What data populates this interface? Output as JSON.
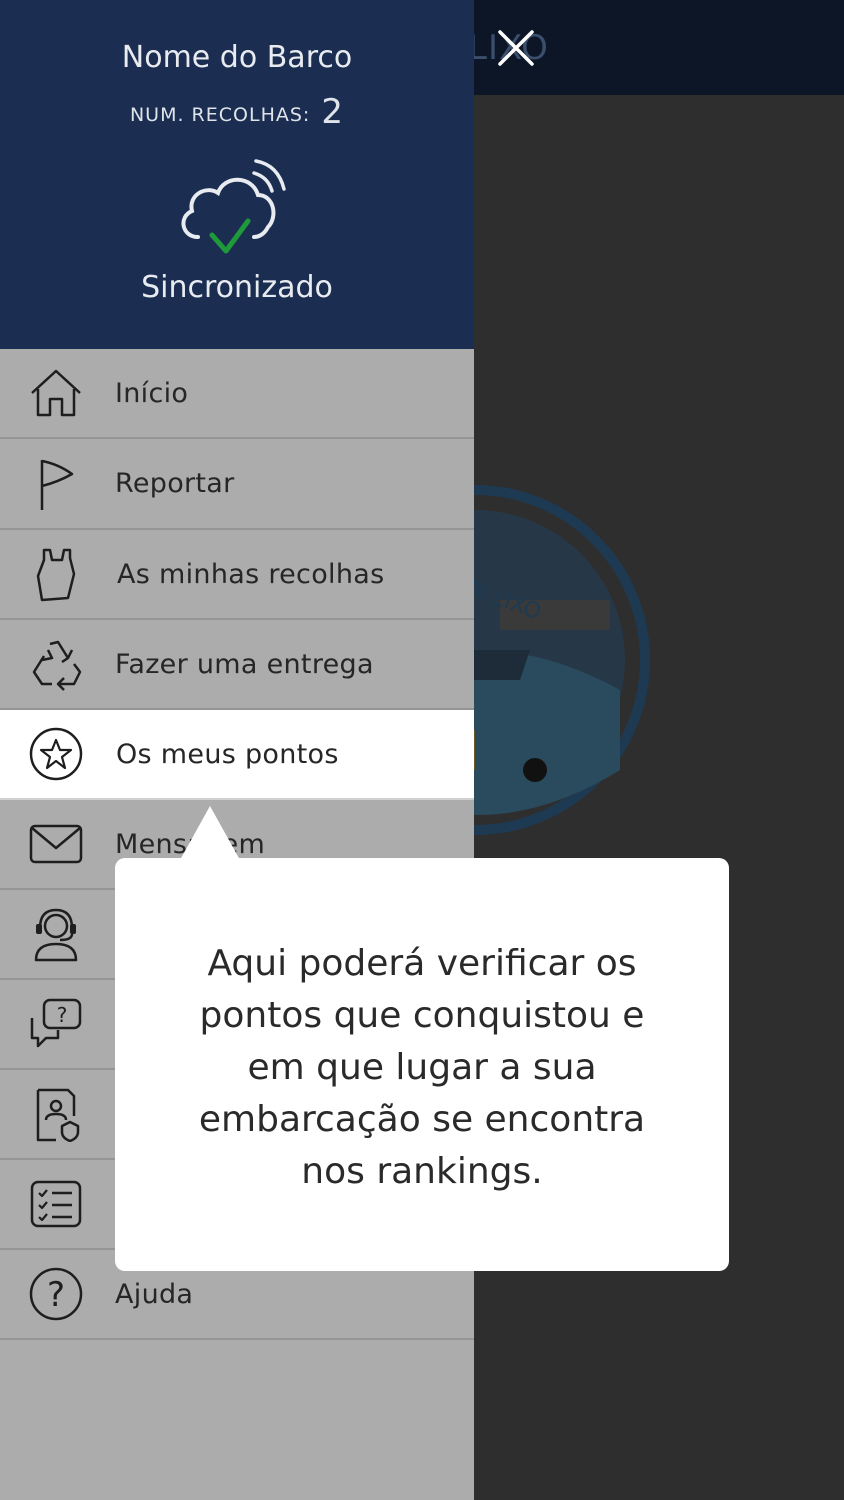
{
  "background": {
    "title_fragment": "LIXO",
    "logo_text": "M LIXO"
  },
  "drawer": {
    "boat_name": "Nome do Barco",
    "collections_label": "NUM. RECOLHAS:",
    "collections_count": "2",
    "sync_status": "Sincronizado",
    "items": [
      {
        "label": "Início",
        "icon": "home-icon"
      },
      {
        "label": "Reportar",
        "icon": "flag-icon"
      },
      {
        "label": "As minhas recolhas",
        "icon": "bag-icon"
      },
      {
        "label": "Fazer uma entrega",
        "icon": "recycle-icon"
      },
      {
        "label": "Os meus pontos",
        "icon": "star-icon",
        "active": true
      },
      {
        "label": "Mensagem",
        "icon": "mail-icon"
      },
      {
        "label": "",
        "icon": "headset-icon"
      },
      {
        "label": "",
        "icon": "question-chat-icon"
      },
      {
        "label": "",
        "icon": "document-shield-icon"
      },
      {
        "label": "",
        "icon": "checklist-icon"
      },
      {
        "label": "Ajuda",
        "icon": "help-icon"
      }
    ]
  },
  "tooltip": {
    "text": "Aqui poderá verificar os pontos que conquistou e em que lugar a sua embarcação se encontra nos rankings."
  },
  "colors": {
    "header_bg": "#1b2e52",
    "drawer_bg": "#acacac",
    "check_green": "#1f9a3a"
  }
}
